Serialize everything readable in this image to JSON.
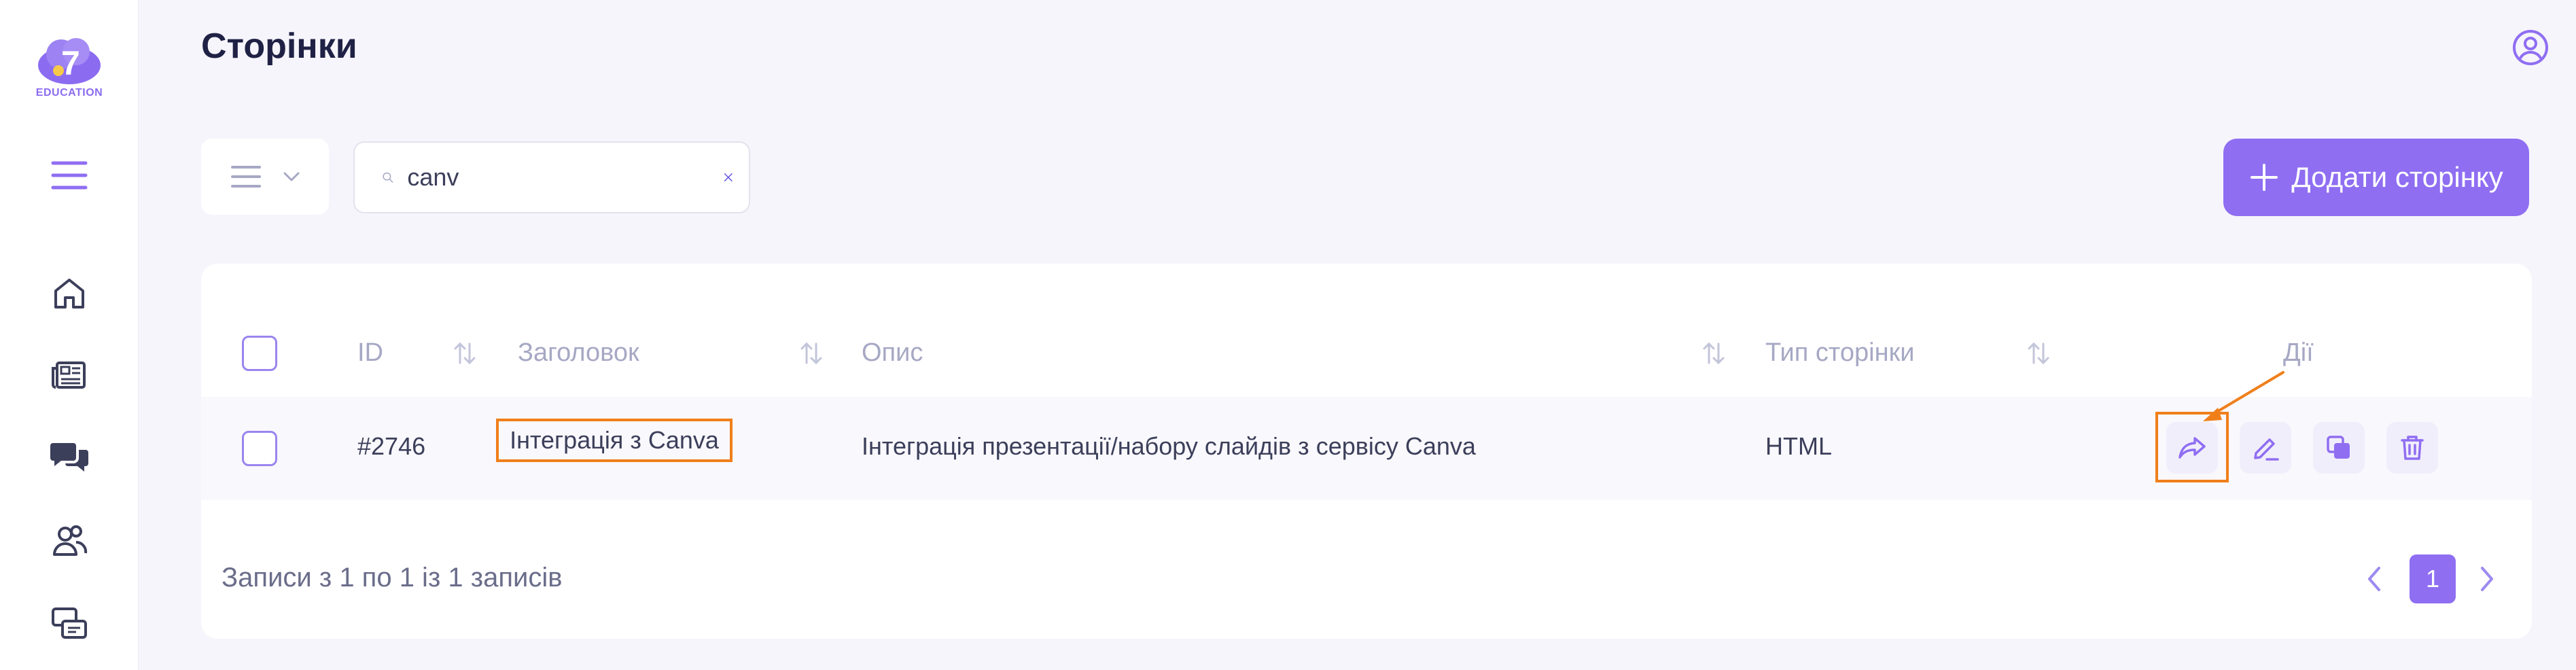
{
  "brand": {
    "logo_text": "EDUCATION"
  },
  "header": {
    "title": "Сторінки"
  },
  "toolbar": {
    "search_value": "canv",
    "add_label": "Додати сторінку"
  },
  "table": {
    "columns": [
      "ID",
      "Заголовок",
      "Опис",
      "Тип сторінки",
      "Дії"
    ],
    "rows": [
      {
        "id": "#2746",
        "title": "Інтеграція з Canva",
        "description": "Інтеграція презентації/набору слайдів з сервісу Canva",
        "type": "HTML"
      }
    ]
  },
  "footer": {
    "records_text": "Записи з 1 по 1 із 1 записів",
    "current_page": "1"
  },
  "colors": {
    "accent": "#8f6ef2",
    "highlight": "#f07f1a"
  }
}
